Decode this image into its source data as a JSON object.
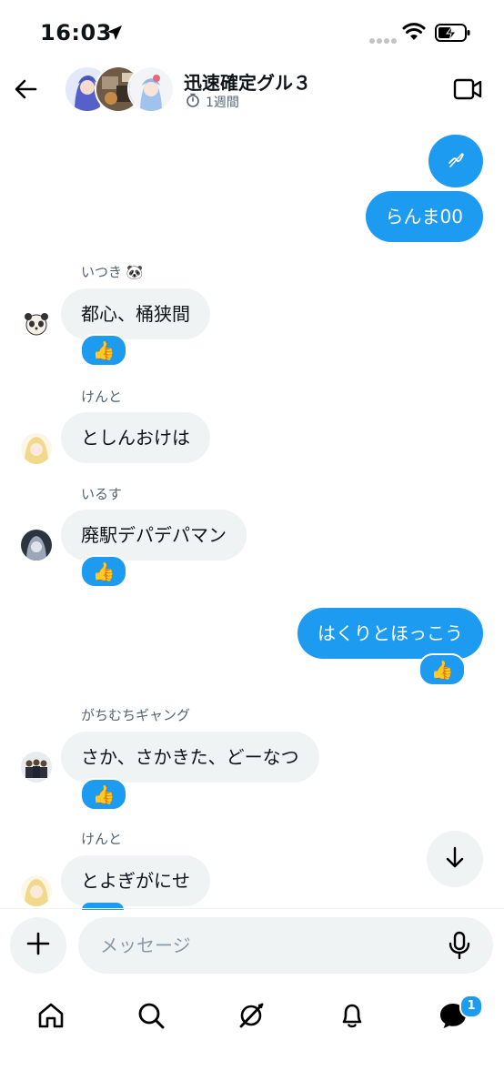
{
  "status_bar": {
    "time": "16:03"
  },
  "header": {
    "title": "迅速確定グル３",
    "subtitle": "1週間"
  },
  "messages": [
    {
      "side": "out",
      "text": "らんま00"
    },
    {
      "side": "in",
      "sender": "いつき 🐼",
      "text": "都心、桶狭間",
      "reaction": "👍"
    },
    {
      "side": "in",
      "sender": "けんと",
      "text": "としんおけは"
    },
    {
      "side": "in",
      "sender": "いるす",
      "text": "廃駅デパデパマン",
      "reaction": "👍"
    },
    {
      "side": "out",
      "text": "はくりとほっこう",
      "reaction": "👍"
    },
    {
      "side": "in",
      "sender": "がちむちギャング",
      "text": "さか、さかきた、どーなつ",
      "reaction": "👍"
    },
    {
      "side": "in",
      "sender": "けんと",
      "text": "とよぎがにせ"
    }
  ],
  "composer": {
    "placeholder": "メッセージ"
  },
  "bottom_nav": {
    "messages_badge": "1"
  },
  "colors": {
    "accent": "#1d9bf0",
    "bubble_in": "#eff3f4",
    "muted": "#536471"
  }
}
